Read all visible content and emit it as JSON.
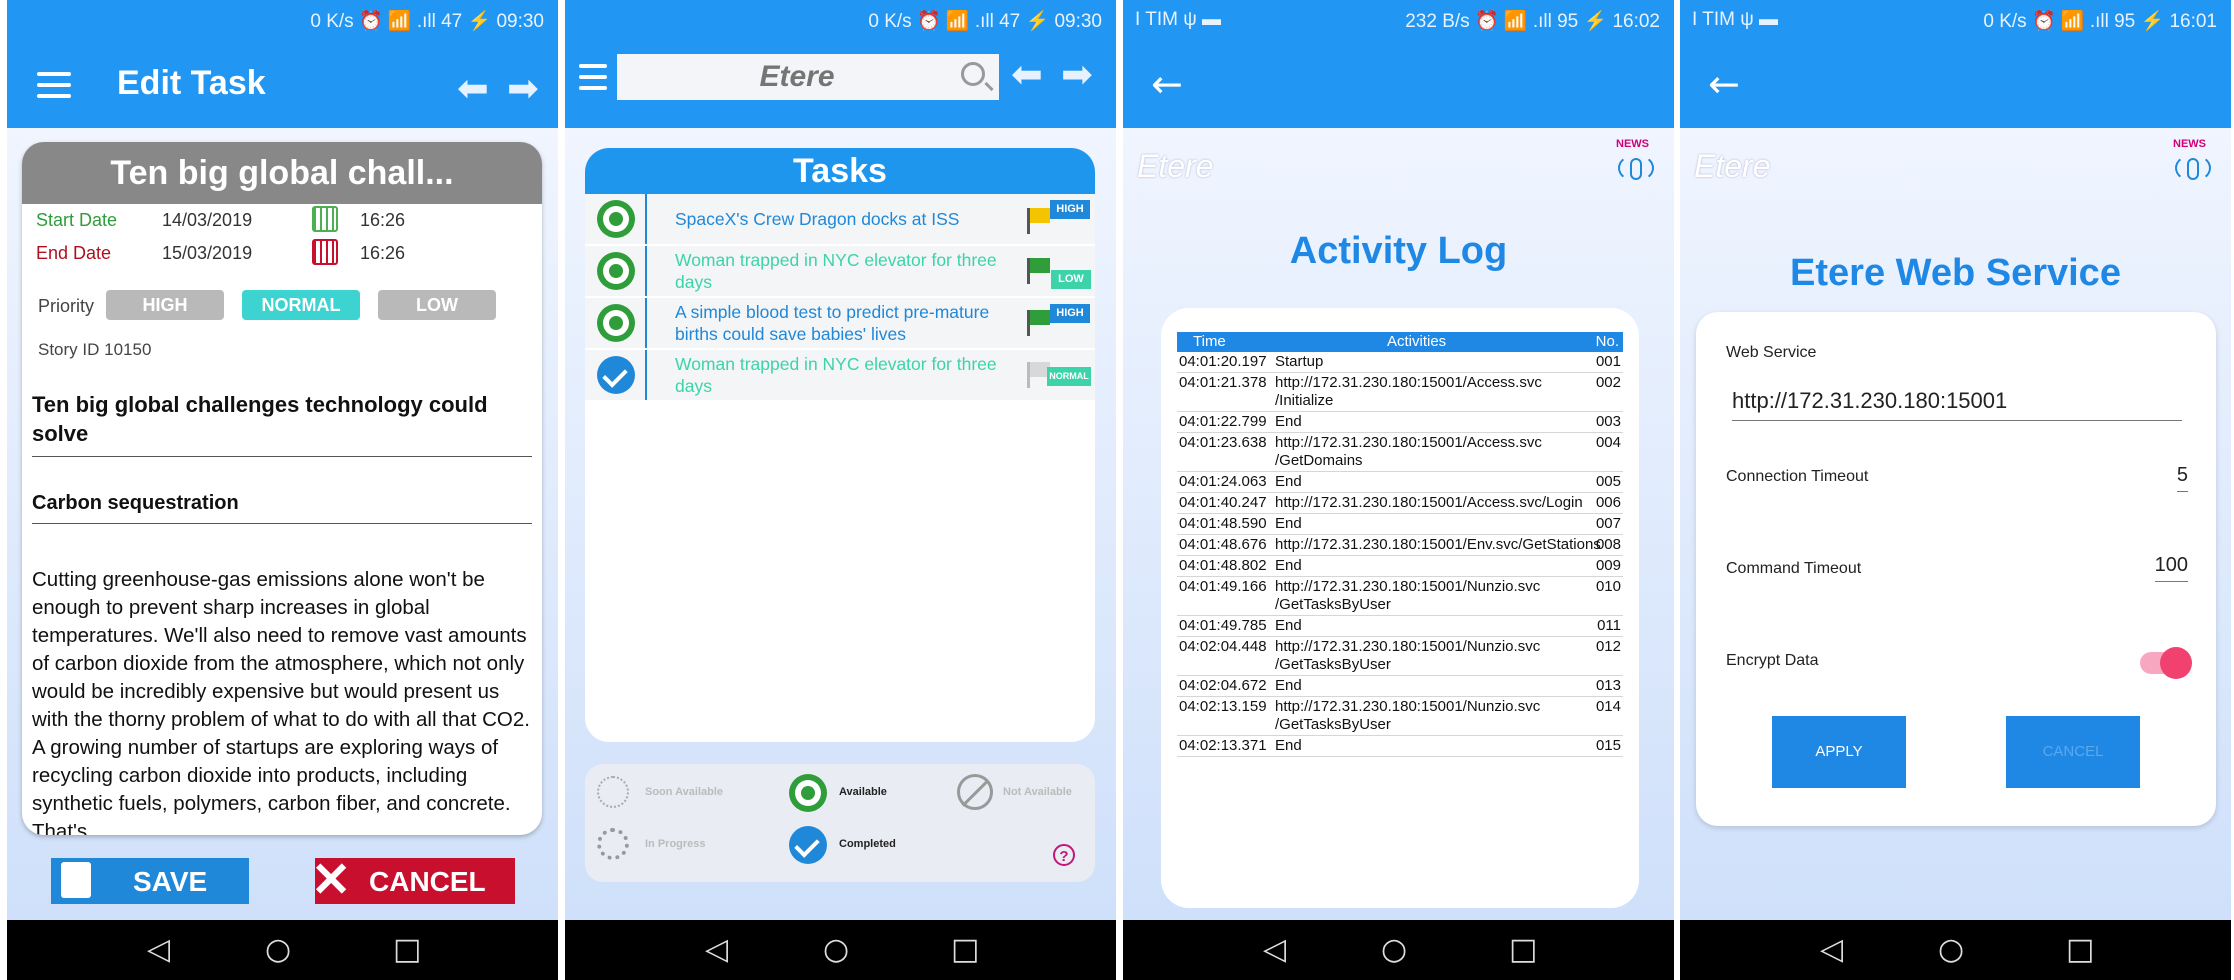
{
  "status_bars": {
    "s1": {
      "left": "",
      "right": "0 K/s ⏰ 📶 .ıll 47 ⚡ 09:30"
    },
    "s2": {
      "left": "",
      "right": "0 K/s ⏰ 📶 .ıll 47 ⚡ 09:30"
    },
    "s3": {
      "left": "I TIM ψ ▬",
      "right": "232 B/s ⏰ 📶 .ıll 95 ⚡ 16:02"
    },
    "s4": {
      "left": "I TIM ψ ▬",
      "right": "0 K/s ⏰ 📶 .ıll 95 ⚡ 16:01"
    }
  },
  "edit_task": {
    "app_title": "Edit Task",
    "card_title": "Ten big global chall...",
    "start_label": "Start Date",
    "start_date": "14/03/2019",
    "start_time": "16:26",
    "end_label": "End Date",
    "end_date": "15/03/2019",
    "end_time": "16:26",
    "priority_label": "Priority",
    "priority_options": [
      "HIGH",
      "NORMAL",
      "LOW"
    ],
    "priority_selected": "NORMAL",
    "story_label": "Story ID",
    "story_id": "10150",
    "article_title": "Ten big global challenges technology could solve",
    "article_subtitle": "Carbon sequestration",
    "article_body": "Cutting greenhouse-gas emissions alone won't be enough to prevent sharp increases in global temperatures.   We'll also need to remove vast amounts of carbon dioxide from the atmosphere, which not only would be incredibly expensive but would present us with the thorny problem of what to do with all that CO2.   A growing number of startups are exploring ways of recycling carbon dioxide into products, including synthetic fuels, polymers, carbon fiber, and concrete.   That's",
    "save_label": "SAVE",
    "cancel_label": "CANCEL"
  },
  "tasks_screen": {
    "search_placeholder": "Etere",
    "panel_title": "Tasks",
    "tasks": [
      {
        "title": "SpaceX's Crew Dragon docks at ISS",
        "state": "available",
        "priority": "HIGH",
        "flag_color": "#f5c400",
        "text_color": "#1f88d8"
      },
      {
        "title": "Woman trapped in NYC elevator for three days",
        "state": "available",
        "priority": "LOW",
        "flag_color": "#2e9d3a",
        "text_color": "#3dd3a8"
      },
      {
        "title": "A simple blood test to predict pre-mature births could save babies' lives",
        "state": "available",
        "priority": "HIGH",
        "flag_color": "#2e9d3a",
        "text_color": "#1f88d8"
      },
      {
        "title": "Woman trapped in NYC elevator for three days",
        "state": "completed",
        "priority": "NORMAL",
        "flag_color": "#d8d8d8",
        "text_color": "#3dd3a8"
      }
    ],
    "legend": {
      "soon_available": "Soon Available",
      "available": "Available",
      "not_available": "Not Available",
      "in_progress": "In Progress",
      "completed": "Completed",
      "help": "?"
    }
  },
  "activity_log": {
    "logo": "Etere",
    "news_label": "NEWS",
    "title": "Activity Log",
    "headers": {
      "time": "Time",
      "activities": "Activities",
      "no": "No."
    },
    "rows": [
      {
        "time": "04:01:20.197",
        "activity": "Startup",
        "no": "001"
      },
      {
        "time": "04:01:21.378",
        "activity": "http://172.31.230.180:15001/Access.svc\n/Initialize",
        "no": "002"
      },
      {
        "time": "04:01:22.799",
        "activity": "End",
        "no": "003"
      },
      {
        "time": "04:01:23.638",
        "activity": "http://172.31.230.180:15001/Access.svc\n/GetDomains",
        "no": "004"
      },
      {
        "time": "04:01:24.063",
        "activity": "End",
        "no": "005"
      },
      {
        "time": "04:01:40.247",
        "activity": "http://172.31.230.180:15001/Access.svc/Login",
        "no": "006"
      },
      {
        "time": "04:01:48.590",
        "activity": "End",
        "no": "007"
      },
      {
        "time": "04:01:48.676",
        "activity": "http://172.31.230.180:15001/Env.svc/GetStations",
        "no": "008"
      },
      {
        "time": "04:01:48.802",
        "activity": "End",
        "no": "009"
      },
      {
        "time": "04:01:49.166",
        "activity": "http://172.31.230.180:15001/Nunzio.svc\n/GetTasksByUser",
        "no": "010"
      },
      {
        "time": "04:01:49.785",
        "activity": "End",
        "no": "011"
      },
      {
        "time": "04:02:04.448",
        "activity": "http://172.31.230.180:15001/Nunzio.svc\n/GetTasksByUser",
        "no": "012"
      },
      {
        "time": "04:02:04.672",
        "activity": "End",
        "no": "013"
      },
      {
        "time": "04:02:13.159",
        "activity": "http://172.31.230.180:15001/Nunzio.svc\n/GetTasksByUser",
        "no": "014"
      },
      {
        "time": "04:02:13.371",
        "activity": "End",
        "no": "015"
      }
    ]
  },
  "web_service": {
    "logo": "Etere",
    "news_label": "NEWS",
    "title": "Etere Web Service",
    "ws_label": "Web Service",
    "ws_url": "http://172.31.230.180:15001",
    "conn_timeout_label": "Connection Timeout",
    "conn_timeout": "5",
    "cmd_timeout_label": "Command Timeout",
    "cmd_timeout": "100",
    "encrypt_label": "Encrypt Data",
    "encrypt_on": true,
    "apply_label": "APPLY",
    "cancel_label": "CANCEL"
  },
  "nav_icons": {
    "back": "◁",
    "home": "○",
    "recent": "□"
  },
  "colors": {
    "primary": "#2196f3",
    "accent_teal": "#3dd3a8",
    "cancel_red": "#c8102e",
    "toggle_pink": "#f0416f"
  }
}
